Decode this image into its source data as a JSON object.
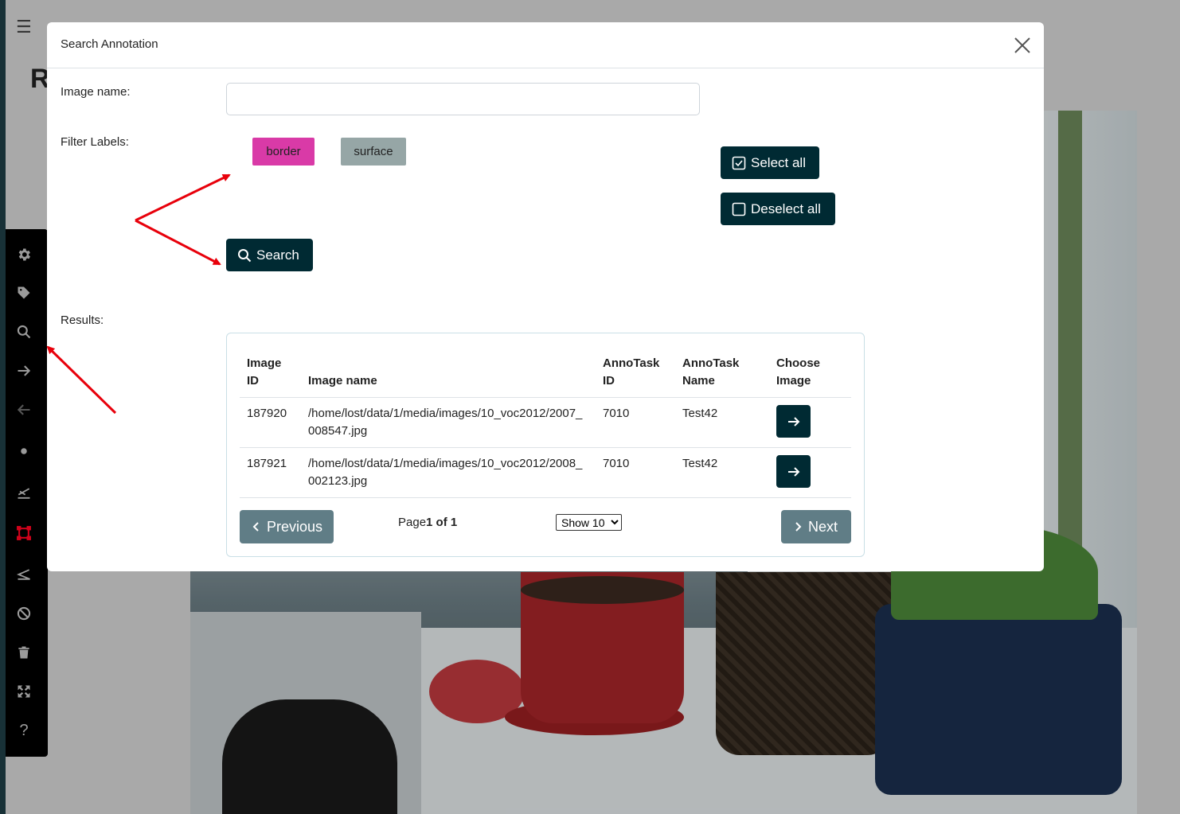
{
  "background": {
    "page_heading_letter": "R"
  },
  "toolbar": {
    "items": [
      {
        "name": "settings",
        "icon": "gear-icon"
      },
      {
        "name": "labels",
        "icon": "tag-icon"
      },
      {
        "name": "search",
        "icon": "search-icon"
      },
      {
        "name": "next",
        "icon": "arrow-right-icon"
      },
      {
        "name": "previous",
        "icon": "arrow-left-icon"
      },
      {
        "name": "point",
        "icon": "dot-icon"
      },
      {
        "name": "line",
        "icon": "line-tool-icon"
      },
      {
        "name": "bbox",
        "icon": "bbox-icon",
        "active_color": "#d0021b"
      },
      {
        "name": "polygon",
        "icon": "polygon-icon"
      },
      {
        "name": "junk",
        "icon": "ban-icon"
      },
      {
        "name": "delete",
        "icon": "trash-icon"
      },
      {
        "name": "fullscreen",
        "icon": "expand-icon"
      },
      {
        "name": "help",
        "icon": "question-icon"
      }
    ]
  },
  "modal": {
    "title": "Search Annotation",
    "image_name_label": "Image name:",
    "image_name_value": "",
    "filter_labels_label": "Filter Labels:",
    "labels": [
      {
        "name": "border",
        "color": "#d93aa7"
      },
      {
        "name": "surface",
        "color": "#96a6a6"
      }
    ],
    "select_all": "Select all",
    "deselect_all": "Deselect all",
    "search": "Search",
    "results_label": "Results:",
    "table": {
      "headers": [
        "Image ID",
        "Image name",
        "AnnoTask ID",
        "AnnoTask Name",
        "Choose Image"
      ],
      "rows": [
        {
          "image_id": "187920",
          "image_name": "/home/lost/data/1/media/images/10_voc2012/2007_008547.jpg",
          "annotask_id": "7010",
          "annotask_name": "Test42"
        },
        {
          "image_id": "187921",
          "image_name": "/home/lost/data/1/media/images/10_voc2012/2008_002123.jpg",
          "annotask_id": "7010",
          "annotask_name": "Test42"
        }
      ]
    },
    "pagination": {
      "previous": "Previous",
      "page_prefix": "Page",
      "page_current": "1 of 1",
      "show": "Show 10",
      "next": "Next"
    }
  },
  "colors": {
    "primary_dark": "#002a33",
    "secondary": "#607d86",
    "annotation_arrow": "#e8000b"
  }
}
